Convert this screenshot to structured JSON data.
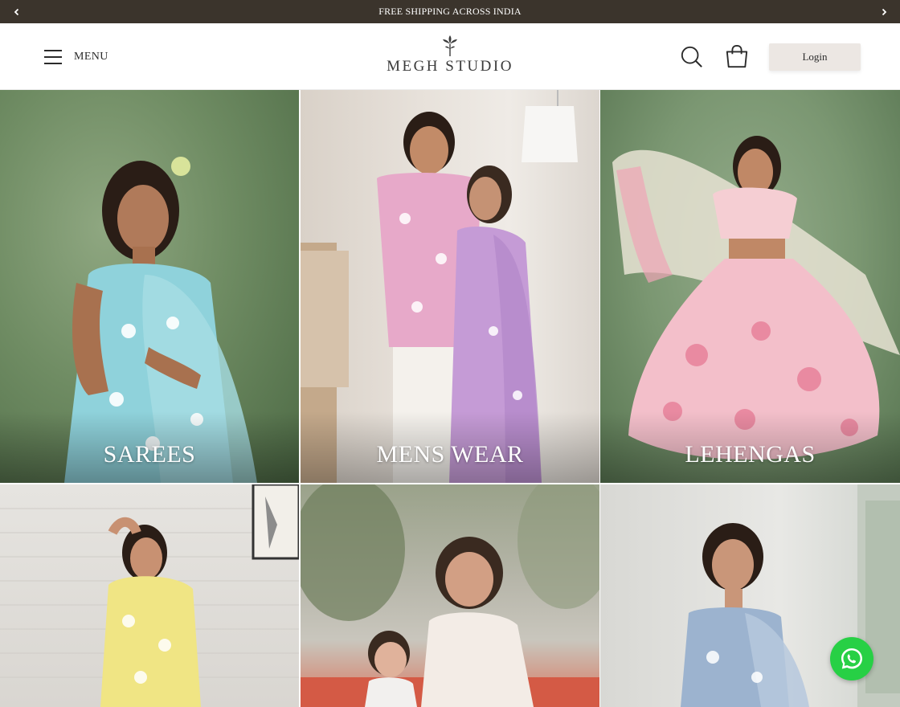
{
  "announcement": {
    "text": "FREE SHIPPING ACROSS INDIA",
    "prev_icon": "chevron-left-icon",
    "next_icon": "chevron-right-icon",
    "bg_color": "#3b342c"
  },
  "header": {
    "menu_label": "MENU",
    "menu_icon": "hamburger-icon",
    "logo_text": "MEGH STUDIO",
    "logo_icon": "flower-icon",
    "search_icon": "search-icon",
    "cart_icon": "shopping-bag-icon",
    "login_label": "Login"
  },
  "collections": [
    {
      "label": "SAREES"
    },
    {
      "label": "MENS WEAR"
    },
    {
      "label": "LEHENGAS"
    },
    {
      "label": ""
    },
    {
      "label": ""
    },
    {
      "label": ""
    }
  ],
  "floating": {
    "whatsapp_icon": "whatsapp-icon",
    "whatsapp_color": "#27d045"
  }
}
